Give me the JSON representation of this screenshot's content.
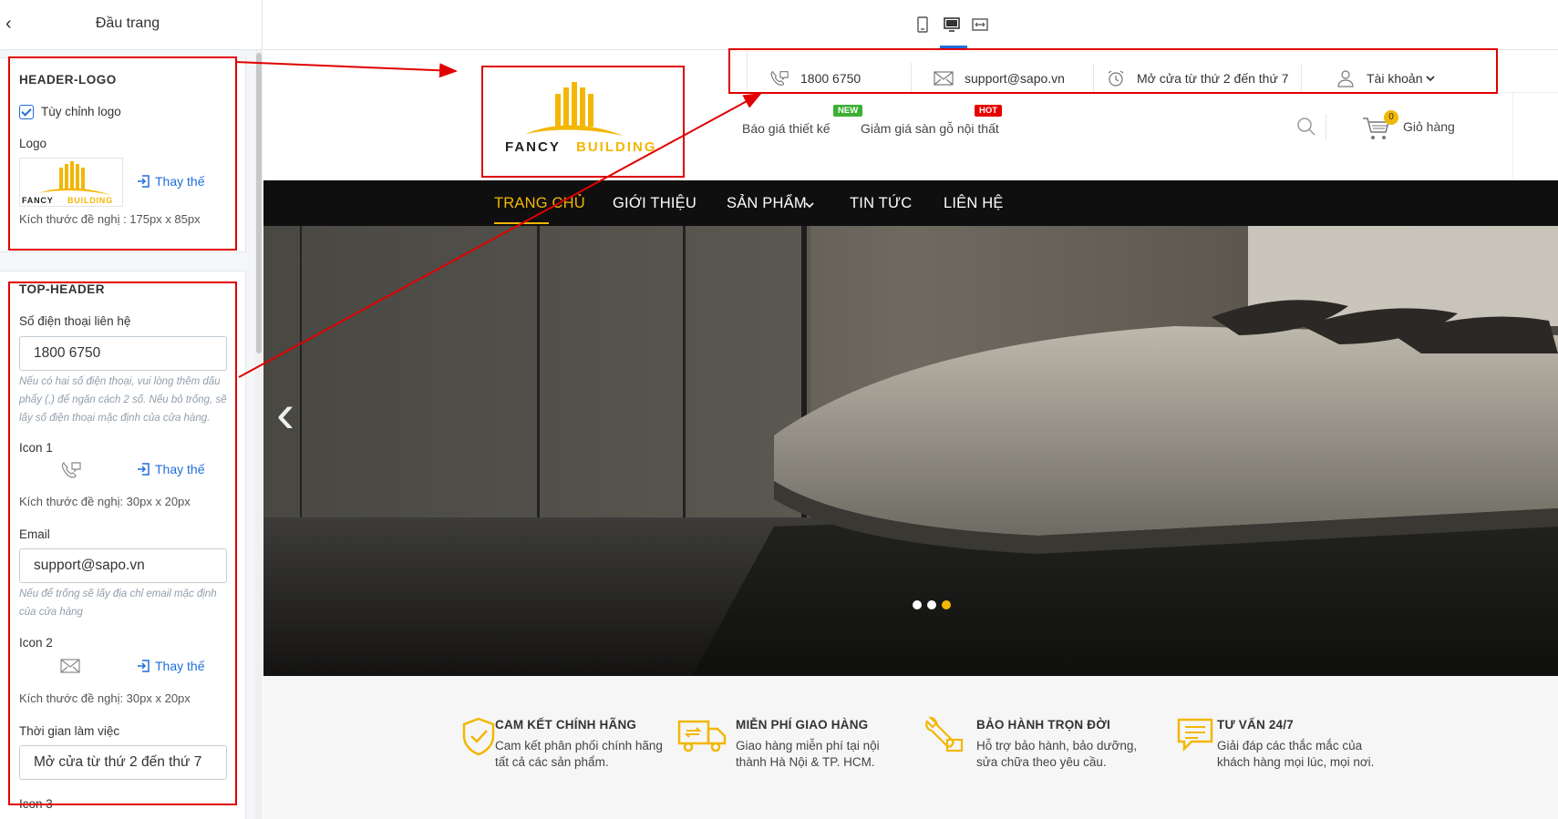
{
  "panel": {
    "title": "Đầu trang",
    "header_logo": {
      "title": "HEADER-LOGO",
      "custom_logo_label": "Tùy chỉnh logo",
      "logo_label": "Logo",
      "replace_label": "Thay thế",
      "size_hint": "Kích thước đề nghị : 175px x 85px"
    },
    "top_header": {
      "title": "TOP-HEADER",
      "phone_label": "Số điện thoại liên hệ",
      "phone_value": "1800 6750",
      "phone_hint": "Nếu có hai số điện thoại, vui lòng thêm dấu phẩy (,) để ngăn cách 2 số. Nếu bỏ trống, sẽ lấy số điện thoại mặc định của cửa hàng.",
      "icon1_label": "Icon 1",
      "icon1_replace": "Thay thế",
      "icon1_hint": "Kích thước đề nghị: 30px x 20px",
      "email_label": "Email",
      "email_value": "support@sapo.vn",
      "email_hint": "Nếu để trống sẽ lấy địa chỉ email mặc định của cửa hàng",
      "icon2_label": "Icon 2",
      "icon2_replace": "Thay thế",
      "icon2_hint": "Kích thước đề nghị: 30px x 20px",
      "hours_label": "Thời gian làm việc",
      "hours_value": "Mở cửa từ thứ 2 đến thứ 7",
      "icon3_label": "Icon 3"
    }
  },
  "logo": {
    "word1": "FANCY",
    "word2": "BUILDING",
    "brand_color": "#f2b705"
  },
  "site": {
    "topbar": {
      "phone": "1800 6750",
      "email": "support@sapo.vn",
      "hours": "Mở cửa từ thứ 2 đến thứ 7",
      "account": "Tài khoản"
    },
    "promo": {
      "link1": "Báo giá thiết kế",
      "badge1": "NEW",
      "link2": "Giảm giá sàn gỗ nội thất",
      "badge2": "HOT"
    },
    "cart": {
      "label": "Giỏ hàng",
      "count": "0"
    },
    "nav": [
      "TRANG CHỦ",
      "GIỚI THIỆU",
      "SẢN PHẨM",
      "TIN TỨC",
      "LIÊN HỆ"
    ],
    "slider": {
      "dot_count": 3,
      "active_dot": 3
    },
    "features": [
      {
        "title": "CAM KẾT CHÍNH HÃNG",
        "line1": "Cam kết phân phối chính hãng",
        "line2": "tất cả các sản phẩm.",
        "icon": "shield-check-icon"
      },
      {
        "title": "MIỄN PHÍ GIAO HÀNG",
        "line1": "Giao hàng miễn phí tại nội",
        "line2": "thành Hà Nội & TP. HCM.",
        "icon": "truck-icon"
      },
      {
        "title": "BẢO HÀNH TRỌN ĐỜI",
        "line1": "Hỗ trợ bảo hành, bảo dưỡng,",
        "line2": "sửa chữa theo yêu cầu.",
        "icon": "tools-icon"
      },
      {
        "title": "TƯ VẤN 24/7",
        "line1": "Giải đáp các thắc mắc của",
        "line2": "khách hàng mọi lúc, mọi nơi.",
        "icon": "chat-icon"
      }
    ]
  },
  "colors": {
    "accent": "#f2b705",
    "link": "#1f6dd9",
    "annotation": "#e00000",
    "badge_new": "#3cb034",
    "badge_hot": "#e60000"
  }
}
